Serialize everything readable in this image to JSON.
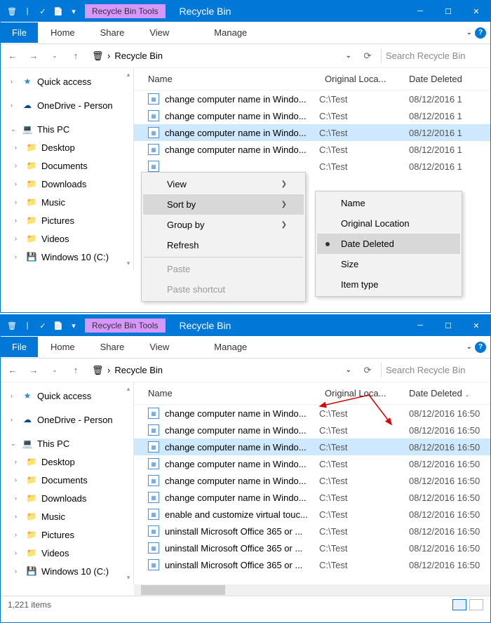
{
  "win1": {
    "tools_tab": "Recycle Bin Tools",
    "title": "Recycle Bin",
    "file_tab": "File",
    "tabs": [
      "Home",
      "Share",
      "View"
    ],
    "manage_tab": "Manage",
    "breadcrumb": "Recycle Bin",
    "search_ph": "Search Recycle Bin",
    "cols": {
      "name": "Name",
      "loc": "Original Loca...",
      "date": "Date Deleted"
    },
    "files": [
      {
        "name": "change computer name in Windo...",
        "loc": "C:\\Test",
        "date": "08/12/2016 1",
        "sel": false
      },
      {
        "name": "change computer name in Windo...",
        "loc": "C:\\Test",
        "date": "08/12/2016 1",
        "sel": false
      },
      {
        "name": "change computer name in Windo...",
        "loc": "C:\\Test",
        "date": "08/12/2016 1",
        "sel": true
      },
      {
        "name": "change computer name in Windo...",
        "loc": "C:\\Test",
        "date": "08/12/2016 1",
        "sel": false
      },
      {
        "name": "",
        "loc": "C:\\Test",
        "date": "08/12/2016 1",
        "sel": false
      }
    ],
    "ctx": {
      "view": "View",
      "sortby": "Sort by",
      "groupby": "Group by",
      "refresh": "Refresh",
      "paste": "Paste",
      "paste_sc": "Paste shortcut"
    },
    "sub": {
      "name": "Name",
      "orig": "Original Location",
      "date": "Date Deleted",
      "size": "Size",
      "type": "Item type"
    },
    "nav": {
      "quick": "Quick access",
      "onedrive": "OneDrive - Person",
      "thispc": "This PC",
      "desktop": "Desktop",
      "documents": "Documents",
      "downloads": "Downloads",
      "music": "Music",
      "pictures": "Pictures",
      "videos": "Videos",
      "win10": "Windows 10 (C:)"
    }
  },
  "win2": {
    "tools_tab": "Recycle Bin Tools",
    "title": "Recycle Bin",
    "file_tab": "File",
    "tabs": [
      "Home",
      "Share",
      "View"
    ],
    "manage_tab": "Manage",
    "breadcrumb": "Recycle Bin",
    "search_ph": "Search Recycle Bin",
    "cols": {
      "name": "Name",
      "loc": "Original Loca...",
      "date": "Date Deleted"
    },
    "files": [
      {
        "name": "change computer name in Windo...",
        "loc": "C:\\Test",
        "date": "08/12/2016 16:50",
        "sel": false
      },
      {
        "name": "change computer name in Windo...",
        "loc": "C:\\Test",
        "date": "08/12/2016 16:50",
        "sel": false
      },
      {
        "name": "change computer name in Windo...",
        "loc": "C:\\Test",
        "date": "08/12/2016 16:50",
        "sel": true
      },
      {
        "name": "change computer name in Windo...",
        "loc": "C:\\Test",
        "date": "08/12/2016 16:50",
        "sel": false
      },
      {
        "name": "change computer name in Windo...",
        "loc": "C:\\Test",
        "date": "08/12/2016 16:50",
        "sel": false
      },
      {
        "name": "change computer name in Windo...",
        "loc": "C:\\Test",
        "date": "08/12/2016 16:50",
        "sel": false
      },
      {
        "name": "enable and customize virtual touc...",
        "loc": "C:\\Test",
        "date": "08/12/2016 16:50",
        "sel": false
      },
      {
        "name": "uninstall Microsoft Office 365 or ...",
        "loc": "C:\\Test",
        "date": "08/12/2016 16:50",
        "sel": false
      },
      {
        "name": "uninstall Microsoft Office 365 or ...",
        "loc": "C:\\Test",
        "date": "08/12/2016 16:50",
        "sel": false
      },
      {
        "name": "uninstall Microsoft Office 365 or ...",
        "loc": "C:\\Test",
        "date": "08/12/2016 16:50",
        "sel": false
      }
    ],
    "status": "1,221 items",
    "nav": {
      "quick": "Quick access",
      "onedrive": "OneDrive - Person",
      "thispc": "This PC",
      "desktop": "Desktop",
      "documents": "Documents",
      "downloads": "Downloads",
      "music": "Music",
      "pictures": "Pictures",
      "videos": "Videos",
      "win10": "Windows 10 (C:)"
    }
  }
}
